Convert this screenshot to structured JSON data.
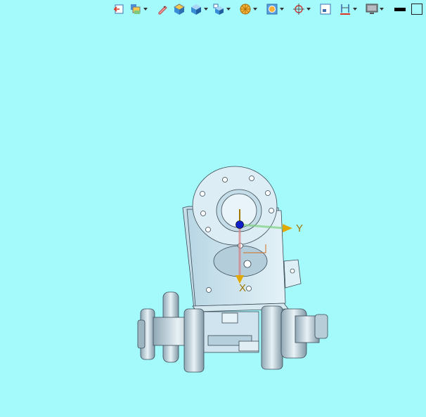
{
  "toolbar": {
    "buttons": [
      {
        "name": "exit-sketch-icon",
        "dropdown": false
      },
      {
        "name": "layers-icon",
        "dropdown": true
      },
      {
        "name": "edit-pen-icon",
        "dropdown": false
      },
      {
        "name": "view-top-icon",
        "dropdown": false
      },
      {
        "name": "view-iso-icon",
        "dropdown": true
      },
      {
        "name": "view-orient-icon",
        "dropdown": true
      },
      {
        "name": "render-style-icon",
        "dropdown": true
      },
      {
        "name": "section-view-icon",
        "dropdown": true
      },
      {
        "name": "snap-target-icon",
        "dropdown": true
      },
      {
        "name": "fit-window-icon",
        "dropdown": false
      },
      {
        "name": "measure-icon",
        "dropdown": true
      },
      {
        "name": "display-monitor-icon",
        "dropdown": true
      },
      {
        "name": "line-color-icon",
        "dropdown": false
      },
      {
        "name": "bg-color-icon",
        "dropdown": false
      }
    ]
  },
  "triad": {
    "y_label": "Y",
    "x_label": "X",
    "z_label": "Z"
  },
  "colors": {
    "background": "#a4f9fb",
    "part_fill": "#cde6f0",
    "part_edge": "#3a4a55",
    "axis_label": "#a07800"
  }
}
